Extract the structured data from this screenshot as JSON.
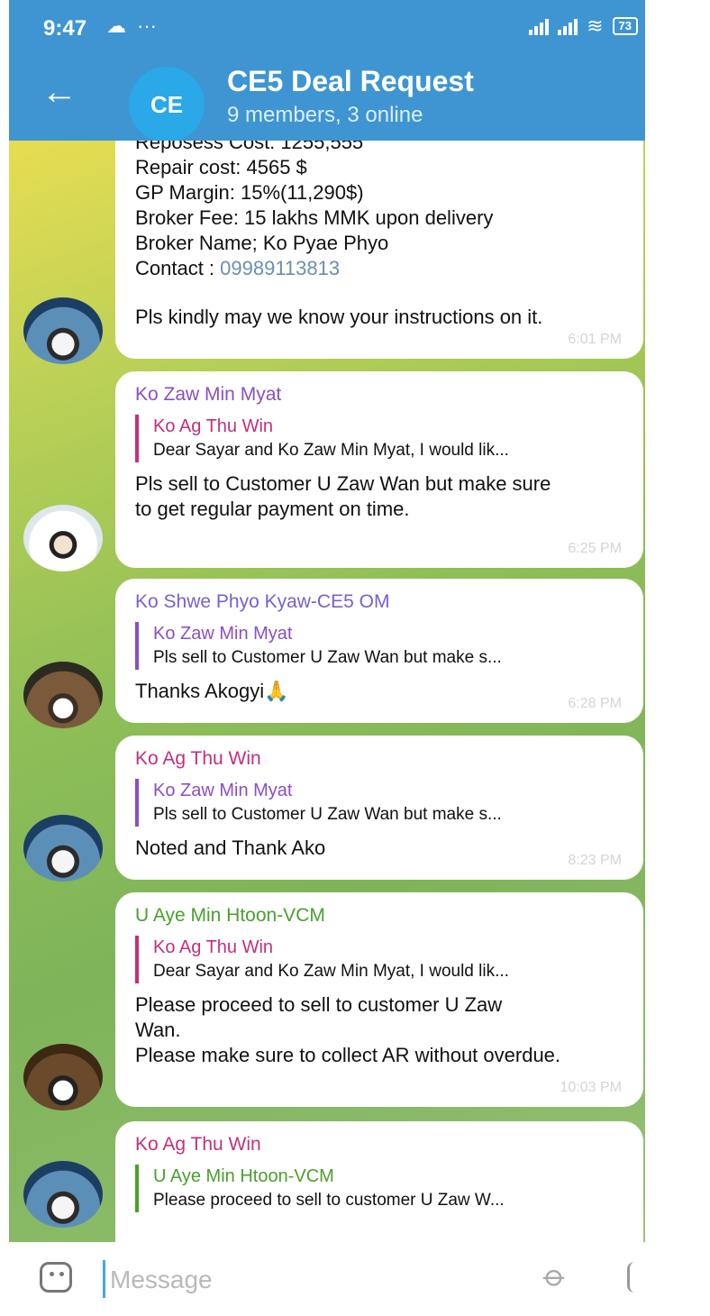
{
  "status_bar": {
    "time": "9:47",
    "battery": "73"
  },
  "header": {
    "avatar_initials": "CE",
    "title": "CE5 Deal Request",
    "subtitle": "9 members, 3 online"
  },
  "messages": [
    {
      "lines": [
        "Reposess Cost: 1255,555",
        "Repair cost:  4565 $",
        "GP Margin:  15%(11,290$)",
        "Broker Fee: 15 lakhs MMK upon delivery",
        "Broker Name; Ko Pyae Phyo"
      ],
      "contact_label": "Contact : ",
      "contact_number": "09989113813",
      "text": "Pls kindly may we know your instructions on it.",
      "time": "6:01 PM"
    },
    {
      "sender": "Ko Zaw Min Myat",
      "reply_name": "Ko Ag Thu Win",
      "reply_text": "Dear Sayar and Ko Zaw Min Myat, I would lik...",
      "text": "Pls sell to Customer U Zaw Wan but make sure to get regular payment on time.",
      "time": "6:25 PM"
    },
    {
      "sender": "Ko Shwe Phyo Kyaw-CE5 OM",
      "reply_name": "Ko Zaw Min Myat",
      "reply_text": "Pls sell to Customer U Zaw Wan but make s...",
      "text": "Thanks Akogyi🙏",
      "time": "6:28 PM"
    },
    {
      "sender": "Ko Ag Thu Win",
      "reply_name": "Ko Zaw Min Myat",
      "reply_text": "Pls sell to Customer U Zaw Wan but make s...",
      "text": "Noted and Thank Ako",
      "time": "8:23 PM"
    },
    {
      "sender": "U Aye Min Htoon-VCM",
      "reply_name": "Ko Ag Thu Win",
      "reply_text": "Dear Sayar and Ko Zaw Min Myat, I would lik...",
      "text_line1": "Please proceed to sell to customer U Zaw Wan.",
      "text_line2": "Please make sure to collect AR without overdue.",
      "time": "10:03 PM"
    },
    {
      "sender": "Ko Ag Thu Win",
      "reply_name": "U Aye Min Htoon-VCM",
      "reply_text": "Please proceed to sell to customer U Zaw W..."
    }
  ],
  "composer": {
    "placeholder": "Message"
  },
  "colors": {
    "header": "#3f95d2",
    "zaw_min_myat": "#8a4fc4",
    "ag_thu_win": "#c42f7c",
    "shwe_phyo_kyaw": "#7a5fd0",
    "aye_min_htoon": "#4aa02c"
  },
  "icons": [
    "back-arrow-icon",
    "cloud-icon",
    "signal-icon",
    "wifi-icon",
    "battery-icon",
    "emoji-icon",
    "attach-icon",
    "mic-icon"
  ]
}
